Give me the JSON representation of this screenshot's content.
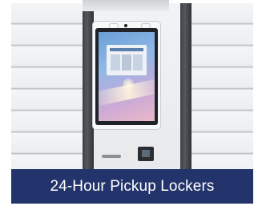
{
  "caption": {
    "text": "24-Hour Pickup Lockers",
    "background": "#23336b",
    "color": "#ffffff"
  },
  "photo": {
    "subject": "locker-kiosk-image"
  }
}
